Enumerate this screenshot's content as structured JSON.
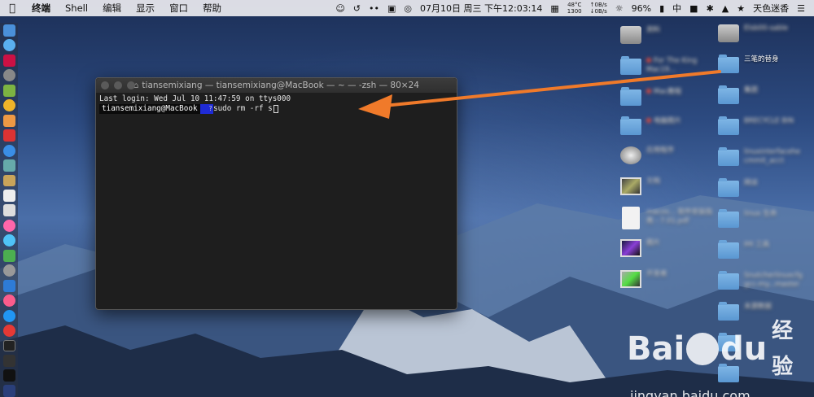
{
  "menubar": {
    "apple": "",
    "app_name": "终端",
    "items": [
      "Shell",
      "编辑",
      "显示",
      "窗口",
      "帮助"
    ],
    "status": {
      "temp": "48°C",
      "rpm": "1300",
      "net_up": "↑0B/s",
      "net_down": "↓0B/s",
      "datetime": "07月10日 周三 下午12:03:14",
      "battery": "96%",
      "input_method": "中",
      "user": "天色迷香"
    }
  },
  "terminal": {
    "title": "tiansemixiang — tiansemixiang@MacBook — ~ — -zsh — 80×24",
    "last_login": "Last login: Wed Jul 10 11:47:59 on ttys000",
    "prompt_user": "tiansemixiang@MacBook",
    "prompt_dir": "~",
    "prompt_git": "?",
    "command": "sudo rm -rf s"
  },
  "desktop": {
    "right_column": [
      "Elsb00-sable",
      "三笔的替身",
      "集团",
      "BRECYCLE BIN",
      "linuxinterfacehe cmmit_acct",
      "网谈",
      "linux 生命",
      "IHI 工具",
      "Snutcherlinuxcfg gcc-my...master",
      "未源数据",
      "",
      ""
    ],
    "left_column": [
      "资料",
      "For The King Mac19...",
      "Mac教程",
      "电脑图片",
      "应用程序",
      "文档",
      "macos... 软件安装指南 - 7.01.pdf",
      "图片",
      "开发者"
    ]
  },
  "watermark": {
    "brand": "Bai",
    "brand2": "du",
    "cn": "经验",
    "url": "jingyan.baidu.com"
  },
  "colors": {
    "arrow": "#f07a2a",
    "prompt_dir_bg": "#1f2bd6"
  }
}
